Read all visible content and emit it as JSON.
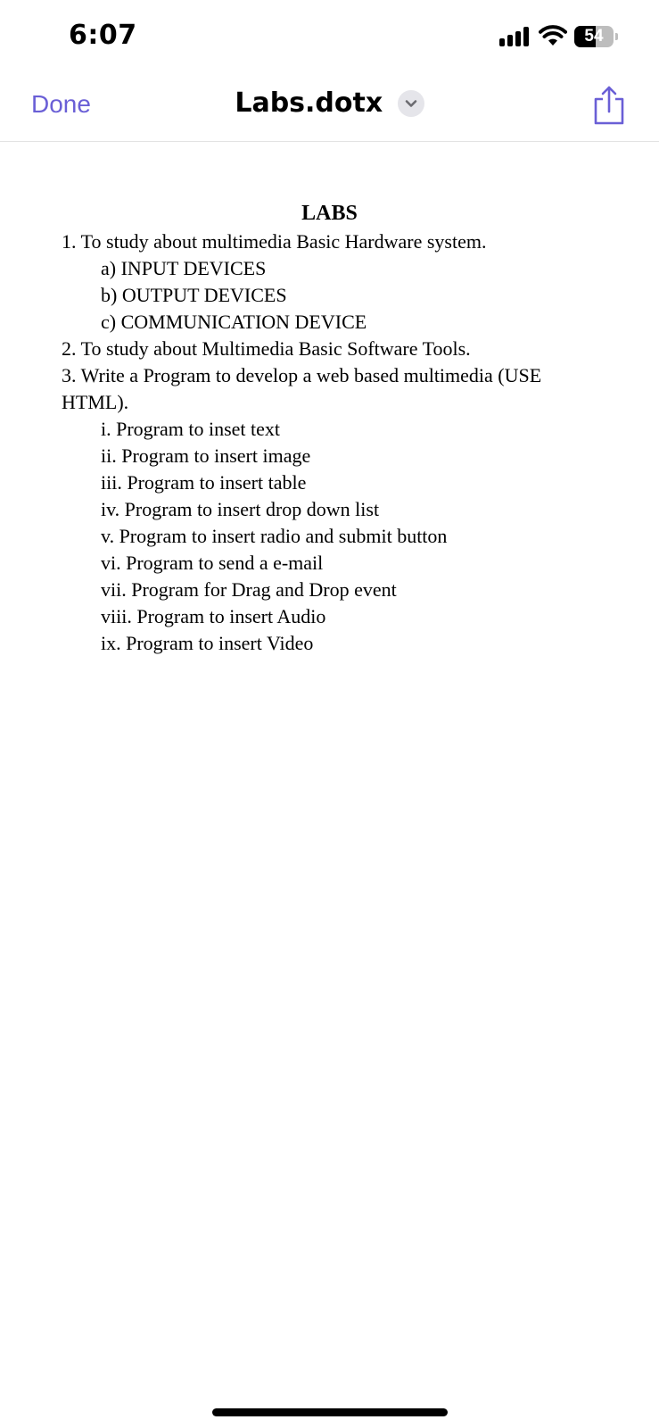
{
  "status_bar": {
    "time": "6:07",
    "battery_level": "54",
    "icons": [
      "cellular-signal-icon",
      "wifi-icon",
      "battery-icon"
    ]
  },
  "nav": {
    "done_label": "Done",
    "file_name": "Labs.dotx",
    "accent_color": "#6a5fd6"
  },
  "document": {
    "title": "LABS",
    "items": [
      {
        "text": "1. To study about multimedia Basic Hardware system.",
        "indent": false
      },
      {
        "text": "a) INPUT DEVICES",
        "indent": true
      },
      {
        "text": "b) OUTPUT DEVICES",
        "indent": true
      },
      {
        "text": "c) COMMUNICATION DEVICE",
        "indent": true
      },
      {
        "text": "2. To study about Multimedia Basic Software Tools.",
        "indent": false
      },
      {
        "text": "3. Write a Program to develop a web based multimedia (USE HTML).",
        "indent": false,
        "wrap": true
      },
      {
        "text": "i. Program to inset text",
        "indent": true
      },
      {
        "text": "ii. Program to insert image",
        "indent": true
      },
      {
        "text": "iii. Program to insert table",
        "indent": true
      },
      {
        "text": "iv. Program to insert drop down list",
        "indent": true
      },
      {
        "text": "v. Program to insert radio and submit button",
        "indent": true
      },
      {
        "text": "vi. Program to send a e-mail",
        "indent": true
      },
      {
        "text": "vii. Program for Drag and Drop event",
        "indent": true
      },
      {
        "text": "viii. Program to insert Audio",
        "indent": true
      },
      {
        "text": "ix. Program to insert Video",
        "indent": true
      }
    ]
  }
}
